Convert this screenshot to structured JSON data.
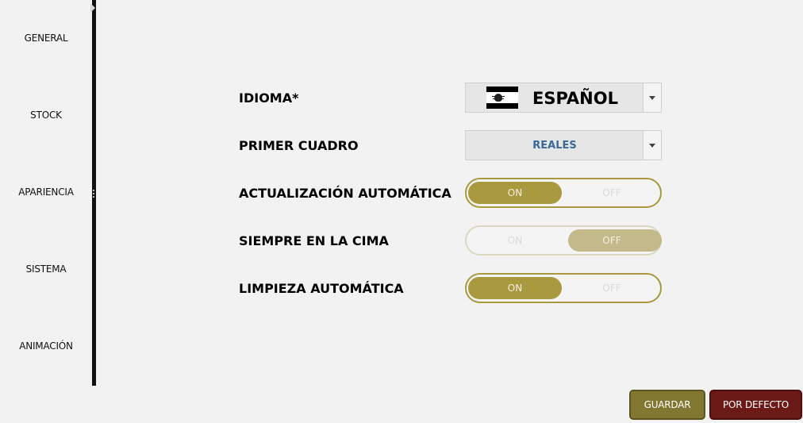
{
  "sidebar": {
    "items": [
      {
        "label": "GENERAL"
      },
      {
        "label": "STOCK"
      },
      {
        "label": "APARIENCIA"
      },
      {
        "label": "SISTEMA"
      },
      {
        "label": "ANIMACIÓN"
      }
    ]
  },
  "settings": {
    "language": {
      "label": "IDIOMA*",
      "value": "ESPAÑOL",
      "flag_icon": "spain-flag-icon"
    },
    "first_panel": {
      "label": "PRIMER CUADRO",
      "value": "REALES"
    },
    "auto_update": {
      "label": "ACTUALIZACIÓN AUTOMÁTICA",
      "on_label": "ON",
      "off_label": "OFF",
      "state": "on"
    },
    "always_on_top": {
      "label": "SIEMPRE EN LA CIMA",
      "on_label": "ON",
      "off_label": "OFF",
      "state": "off"
    },
    "auto_clean": {
      "label": "LIMPIEZA AUTOMÁTICA",
      "on_label": "ON",
      "off_label": "OFF",
      "state": "on"
    }
  },
  "buttons": {
    "save_label": "GUARDAR",
    "default_label": "POR DEFECTO"
  },
  "colors": {
    "accent": "#a8993f",
    "save_button": "#817730",
    "default_button": "#6b1a18",
    "select_value": "#3a6a9a"
  }
}
